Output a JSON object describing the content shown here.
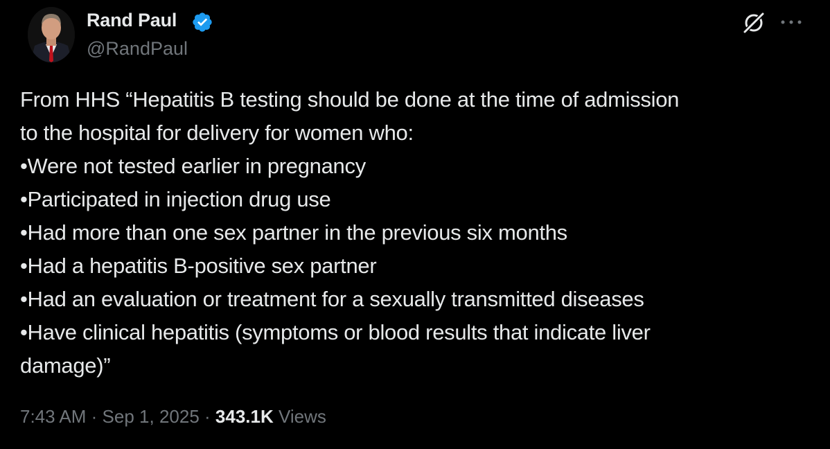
{
  "author": {
    "name": "Rand Paul",
    "handle": "@RandPaul",
    "verified": true,
    "badge_color": "#1d9bf0"
  },
  "tweet": {
    "lines": [
      "From HHS “Hepatitis B testing should be done at the time of admission",
      "to the hospital for delivery for women who:",
      "•Were not tested earlier in pregnancy",
      "•Participated in injection drug use",
      "•Had more than one sex partner in the previous six months",
      "•Had a hepatitis B-positive sex partner",
      "•Had an evaluation or treatment for a sexually transmitted diseases",
      "•Have clinical hepatitis (symptoms or blood results that indicate liver",
      "damage)”"
    ]
  },
  "meta": {
    "time": "7:43 AM",
    "separator": "·",
    "date": "Sep 1, 2025",
    "views_count": "343.1K",
    "views_label": "Views"
  },
  "icons": {
    "grok": "grok-icon",
    "more": "more-options-icon"
  },
  "colors": {
    "background": "#000000",
    "text_primary": "#e7e9ea",
    "text_secondary": "#71767b"
  }
}
